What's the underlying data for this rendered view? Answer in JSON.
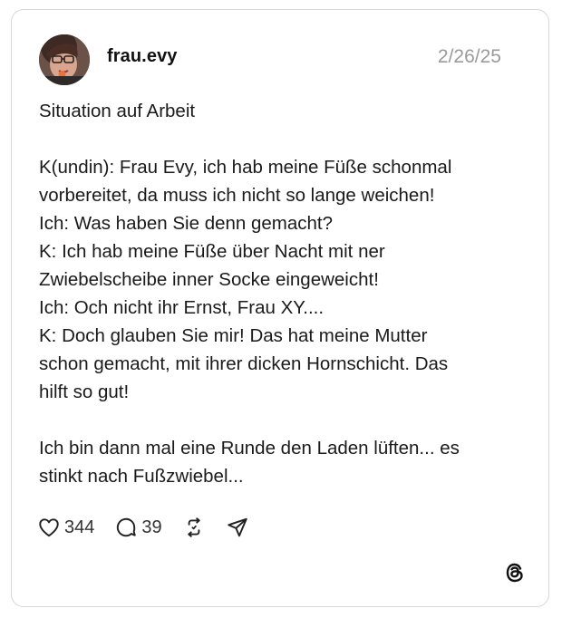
{
  "post": {
    "author": {
      "username": "frau.evy",
      "avatar_icon": "profile-avatar"
    },
    "date": "2/26/25",
    "lines": [
      "Situation auf Arbeit",
      "",
      "K(undin): Frau Evy, ich hab meine Füße schonmal",
      "vorbereitet, da muss ich nicht so lange weichen!",
      "Ich: Was haben Sie denn gemacht?",
      "K: Ich hab meine Füße über Nacht mit ner",
      "Zwiebelscheibe inner Socke eingeweicht!",
      "Ich: Och nicht ihr Ernst, Frau XY....",
      "K: Doch glauben Sie mir! Das hat meine Mutter",
      "schon gemacht, mit ihrer dicken Hornschicht. Das",
      "hilft so gut!",
      "",
      "Ich bin dann mal eine Runde den Laden lüften... es",
      "stinkt nach Fußzwiebel..."
    ],
    "actions": {
      "likes": "344",
      "replies": "39",
      "like_icon": "heart-icon",
      "reply_icon": "comment-icon",
      "repost_icon": "repost-icon",
      "share_icon": "share-icon"
    },
    "brand_icon": "threads-logo-icon",
    "colors": {
      "text": "#1a1a1a",
      "muted": "#9a9a9a",
      "border": "#d7d7d7"
    }
  }
}
